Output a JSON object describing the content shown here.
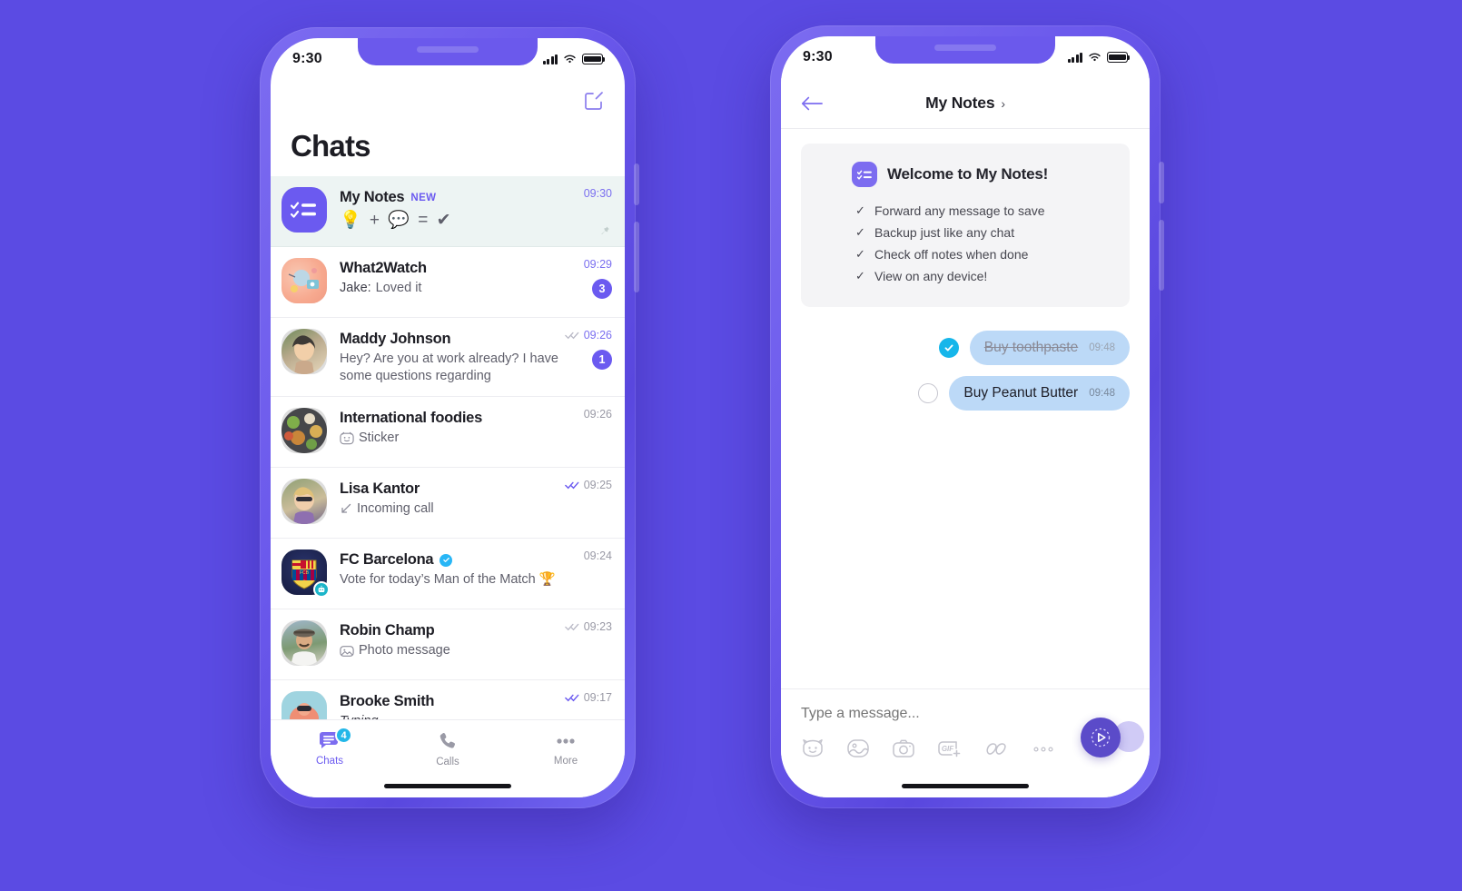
{
  "app": {
    "brand_purple": "#5B4BE3",
    "accent_purple": "#6B5AF0",
    "accent_cyan": "#23b7e8"
  },
  "left_phone": {
    "status": {
      "time": "9:30",
      "signal_icon": "signal-bars-icon",
      "wifi_icon": "wifi-icon",
      "battery_icon": "battery-icon"
    },
    "header": {
      "title": "Chats",
      "compose_icon": "compose-icon"
    },
    "chats": [
      {
        "name": "My Notes",
        "badge": "NEW",
        "preview": "💡 + 💬 = ✔",
        "preview_kind": "emoji",
        "time": "09:30",
        "pinned": true,
        "avatar_kind": "notes-checklist",
        "unread": "",
        "ticks": ""
      },
      {
        "name": "What2Watch",
        "preview_prefix": "Jake:",
        "preview": "Loved it",
        "time": "09:29",
        "unread": "3",
        "avatar_kind": "what2watch",
        "ticks": ""
      },
      {
        "name": "Maddy Johnson",
        "preview": "Hey? Are you at work already? I have some questions regarding",
        "time": "09:26",
        "unread": "1",
        "avatar_kind": "photo-maddy",
        "ticks": "double-check-grey"
      },
      {
        "name": "International foodies",
        "preview": "Sticker",
        "preview_icon": "sticker-icon",
        "time": "09:26",
        "unread": "",
        "avatar_kind": "photo-food",
        "ticks": ""
      },
      {
        "name": "Lisa Kantor",
        "preview": "Incoming call",
        "preview_icon": "incoming-call-icon",
        "time": "09:25",
        "unread": "",
        "avatar_kind": "photo-lisa",
        "ticks": "double-check-purple"
      },
      {
        "name": "FC Barcelona",
        "verified": true,
        "preview": "Vote for today’s Man of the Match 🏆",
        "time": "09:24",
        "unread": "",
        "avatar_kind": "fcb-crest",
        "bot_badge": true,
        "ticks": ""
      },
      {
        "name": "Robin Champ",
        "preview": "Photo message",
        "preview_icon": "photo-message-icon",
        "time": "09:23",
        "unread": "",
        "avatar_kind": "photo-robin",
        "ticks": "double-check-grey"
      },
      {
        "name": "Brooke Smith",
        "preview": "Typing...",
        "preview_italic": true,
        "time": "09:17",
        "unread": "",
        "avatar_kind": "photo-brooke",
        "ticks": "double-check-purple"
      }
    ],
    "tabs": [
      {
        "label": "Chats",
        "icon": "chats-icon",
        "badge": "4",
        "active": true
      },
      {
        "label": "Calls",
        "icon": "phone-icon",
        "badge": "",
        "active": false
      },
      {
        "label": "More",
        "icon": "more-dots-icon",
        "badge": "",
        "active": false
      }
    ]
  },
  "right_phone": {
    "status": {
      "time": "9:30",
      "signal_icon": "signal-bars-icon",
      "wifi_icon": "wifi-icon",
      "battery_icon": "battery-icon"
    },
    "header": {
      "back_icon": "back-arrow-icon",
      "title": "My Notes",
      "chevron": "›"
    },
    "welcome": {
      "icon": "notes-checklist-icon",
      "title": "Welcome to My Notes!",
      "items": [
        "Forward any message to save",
        "Backup just like any chat",
        "Check off notes when done",
        "View on any device!"
      ]
    },
    "messages": [
      {
        "text": "Buy toothpaste",
        "time": "09:48",
        "checked": true
      },
      {
        "text": "Buy Peanut Butter",
        "time": "09:48",
        "checked": false
      }
    ],
    "input": {
      "placeholder": "Type a message...",
      "value": "",
      "tools": [
        {
          "icon": "sticker-cat-icon",
          "name": "stickers"
        },
        {
          "icon": "image-icon",
          "name": "gallery"
        },
        {
          "icon": "camera-icon",
          "name": "camera"
        },
        {
          "icon": "gif-plus-icon",
          "name": "gif"
        },
        {
          "icon": "doodle-icon",
          "name": "doodle"
        },
        {
          "icon": "more-dots-icon",
          "name": "more"
        }
      ],
      "send_icon": "send-play-icon"
    }
  }
}
